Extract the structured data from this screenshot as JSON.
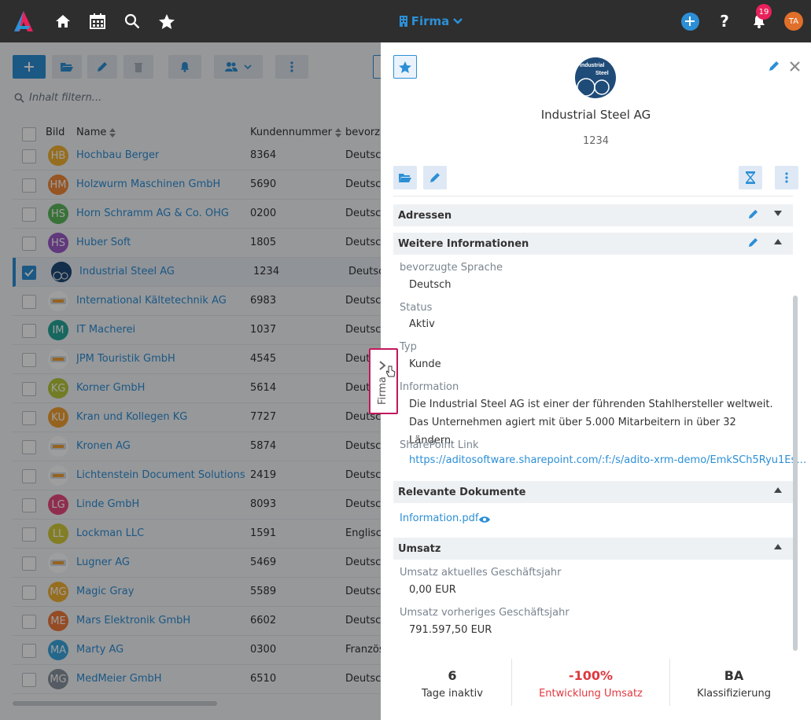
{
  "topbar": {
    "module_label": "Firma",
    "notification_count": "19",
    "user_initials": "TA",
    "colors": {
      "accent": "#2c8fd6",
      "bar": "#2e2e2e",
      "badge": "#e8215b"
    }
  },
  "list": {
    "filter_placeholder": "Inhalt filtern...",
    "columns": [
      "Bild",
      "Name",
      "Kundennummer",
      "bevorzu"
    ],
    "rows": [
      {
        "initials": "HB",
        "color": "#f2b233",
        "name": "Hochbau Berger",
        "num": "8364",
        "lang": "Deutsch"
      },
      {
        "initials": "HM",
        "color": "#f08a3a",
        "name": "Holzwurm Maschinen GmbH",
        "num": "5690",
        "lang": "Deutsch"
      },
      {
        "initials": "HS",
        "color": "#5cb85c",
        "name": "Horn Schramm AG & Co. OHG",
        "num": "0200",
        "lang": "Deutsch"
      },
      {
        "initials": "HS",
        "color": "#9c5bc9",
        "name": "Huber Soft",
        "num": "1805",
        "lang": "Deutsch"
      },
      {
        "initials": "",
        "color": "#1f4b78",
        "name": "Industrial Steel AG",
        "num": "1234",
        "lang": "Deutsch",
        "selected": true,
        "logo": true
      },
      {
        "initials": "",
        "color": "#ffffff",
        "name": "International Kältetechnik AG",
        "num": "6983",
        "lang": "Deutsch",
        "logo": true
      },
      {
        "initials": "IM",
        "color": "#26a69a",
        "name": "IT Macherei",
        "num": "1037",
        "lang": "Deutsch"
      },
      {
        "initials": "",
        "color": "#ffffff",
        "name": "JPM Touristik GmbH",
        "num": "4545",
        "lang": "Deutsch",
        "logo": true
      },
      {
        "initials": "KG",
        "color": "#b8c93a",
        "name": "Korner GmbH",
        "num": "5614",
        "lang": "Deutsch"
      },
      {
        "initials": "KU",
        "color": "#f2a033",
        "name": "Kran und Kollegen KG",
        "num": "7727",
        "lang": "Deutsch"
      },
      {
        "initials": "",
        "color": "#ffffff",
        "name": "Kronen AG",
        "num": "5874",
        "lang": "Deutsch",
        "logo": true
      },
      {
        "initials": "",
        "color": "#ffffff",
        "name": "Lichtenstein Document Solutions Gr",
        "num": "2419",
        "lang": "Deutsch",
        "logo": true
      },
      {
        "initials": "LG",
        "color": "#e84a7f",
        "name": "Linde GmbH",
        "num": "8093",
        "lang": "Deutsch"
      },
      {
        "initials": "LL",
        "color": "#d4cc3a",
        "name": "Lockman LLC",
        "num": "1591",
        "lang": "Englisch"
      },
      {
        "initials": "",
        "color": "#ffffff",
        "name": "Lugner AG",
        "num": "5469",
        "lang": "Deutsch",
        "logo": true
      },
      {
        "initials": "MG",
        "color": "#f2b233",
        "name": "Magic Gray",
        "num": "5589",
        "lang": "Deutsch"
      },
      {
        "initials": "ME",
        "color": "#f07a3a",
        "name": "Mars Elektronik GmbH",
        "num": "6602",
        "lang": "Deutsch"
      },
      {
        "initials": "MA",
        "color": "#3aa7e0",
        "name": "Marty AG",
        "num": "0300",
        "lang": "Französ"
      },
      {
        "initials": "MG",
        "color": "#8a949e",
        "name": "MedMeier GmbH",
        "num": "6510",
        "lang": "Deutsch"
      }
    ]
  },
  "sidetab": {
    "label": "Firma"
  },
  "detail": {
    "company": "Industrial Steel AG",
    "customer_number": "1234",
    "logo_text": "Industrial Steel",
    "sections": {
      "addresses": "Adressen",
      "more_info": "Weitere Informationen",
      "documents": "Relevante Dokumente",
      "revenue": "Umsatz"
    },
    "fields": {
      "language_label": "bevorzugte Sprache",
      "language_value": "Deutsch",
      "status_label": "Status",
      "status_value": "Aktiv",
      "type_label": "Typ",
      "type_value": "Kunde",
      "info_label": "Information",
      "info_value": "Die Industrial Steel AG ist einer der führenden Stahlhersteller weltweit. Das Unternehmen agiert mit über 5.000 Mitarbeitern in über 32 Ländern.",
      "sharepoint_label": "SharePoint Link",
      "sharepoint_value": "https://aditosoftware.sharepoint.com/:f:/s/adito-xrm-demo/EmkSCh5Ryu1Es…"
    },
    "document": "Information.pdf",
    "revenue": {
      "current_label": "Umsatz aktuelles Geschäftsjahr",
      "current_value": "0,00 EUR",
      "previous_label": "Umsatz vorheriges Geschäftsjahr",
      "previous_value": "791.597,50 EUR"
    },
    "kpis": [
      {
        "value": "6",
        "label": "Tage inaktiv"
      },
      {
        "value": "-100%",
        "label": "Entwicklung Umsatz"
      },
      {
        "value": "BA",
        "label": "Klassifizierung"
      }
    ]
  }
}
